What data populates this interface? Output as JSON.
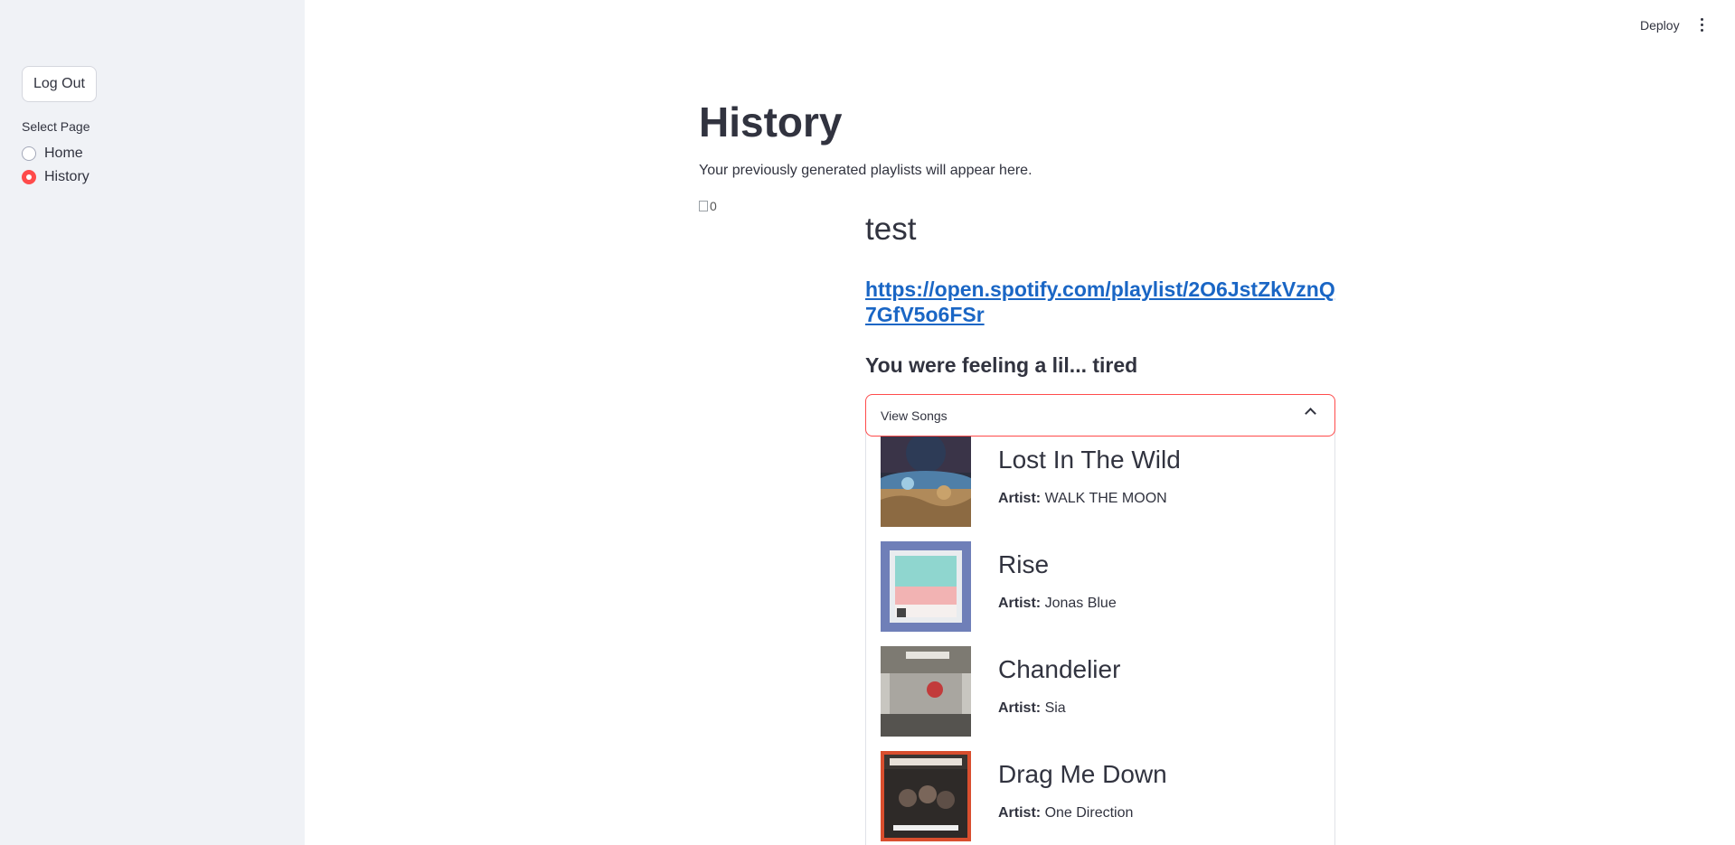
{
  "header": {
    "deploy_label": "Deploy"
  },
  "sidebar": {
    "logout_label": "Log Out",
    "select_label": "Select Page",
    "pages": [
      {
        "label": "Home",
        "selected": false
      },
      {
        "label": "History",
        "selected": true
      }
    ]
  },
  "main": {
    "title": "History",
    "description": "Your previously generated playlists will appear here.",
    "image_alt": "0",
    "playlist": {
      "name": "test",
      "link": "https://open.spotify.com/playlist/2O6JstZkVznQ7GfV5o6FSr",
      "mood": "You were feeling a lil... tired",
      "expander_label": "View Songs",
      "artist_prefix": "Artist:",
      "songs": [
        {
          "title": "Lost In The Wild",
          "artist": "WALK THE MOON"
        },
        {
          "title": "Rise",
          "artist": "Jonas Blue"
        },
        {
          "title": "Chandelier",
          "artist": "Sia"
        },
        {
          "title": "Drag Me Down",
          "artist": "One Direction"
        }
      ]
    }
  },
  "colors": {
    "accent": "#ff4b4b",
    "link": "#1a66c5",
    "sidebar_bg": "#f0f2f6"
  }
}
